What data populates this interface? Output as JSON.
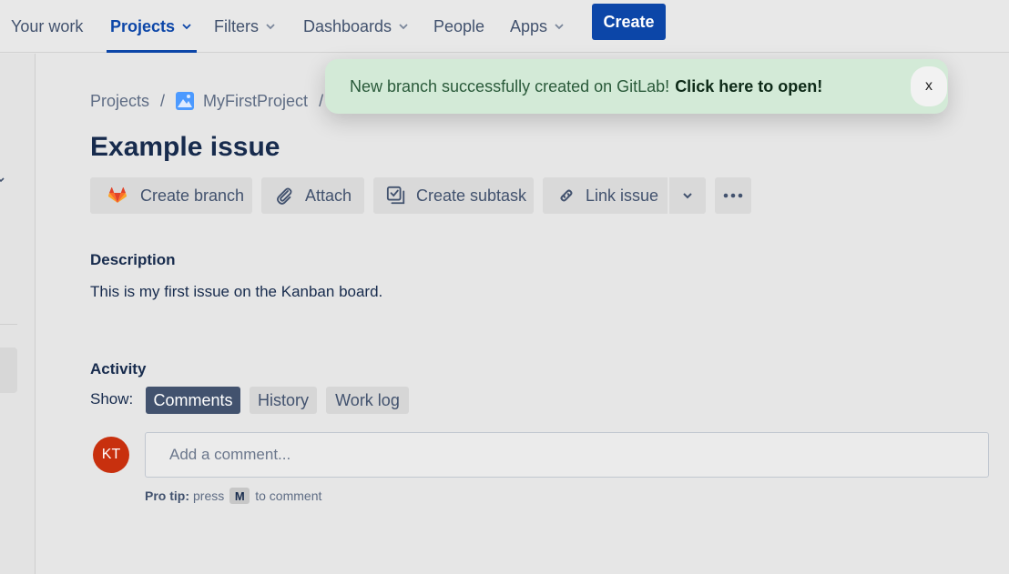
{
  "nav": {
    "your_work": "Your work",
    "projects": "Projects",
    "filters": "Filters",
    "dashboards": "Dashboards",
    "people": "People",
    "apps": "Apps",
    "create": "Create"
  },
  "breadcrumb": {
    "root": "Projects",
    "project": "MyFirstProject"
  },
  "issue": {
    "title": "Example issue"
  },
  "toolbar": {
    "create_branch": "Create branch",
    "attach": "Attach",
    "create_subtask": "Create subtask",
    "link_issue": "Link issue"
  },
  "description": {
    "label": "Description",
    "text": "This is my first issue on the Kanban board."
  },
  "activity": {
    "label": "Activity",
    "show_label": "Show:",
    "tabs": [
      "Comments",
      "History",
      "Work log"
    ],
    "active_tab": "Comments"
  },
  "comment": {
    "avatar_initials": "KT",
    "placeholder": "Add a comment...",
    "pro_tip_label": "Pro tip:",
    "pro_tip_pre": "press",
    "pro_tip_key": "M",
    "pro_tip_post": "to comment"
  },
  "toast": {
    "message": "New branch successfully created on GitLab!",
    "link": "Click here to open!",
    "close": "x",
    "bg_color": "#d3ead7"
  },
  "colors": {
    "brand": "#0c46a8",
    "avatar": "#c8300e"
  }
}
